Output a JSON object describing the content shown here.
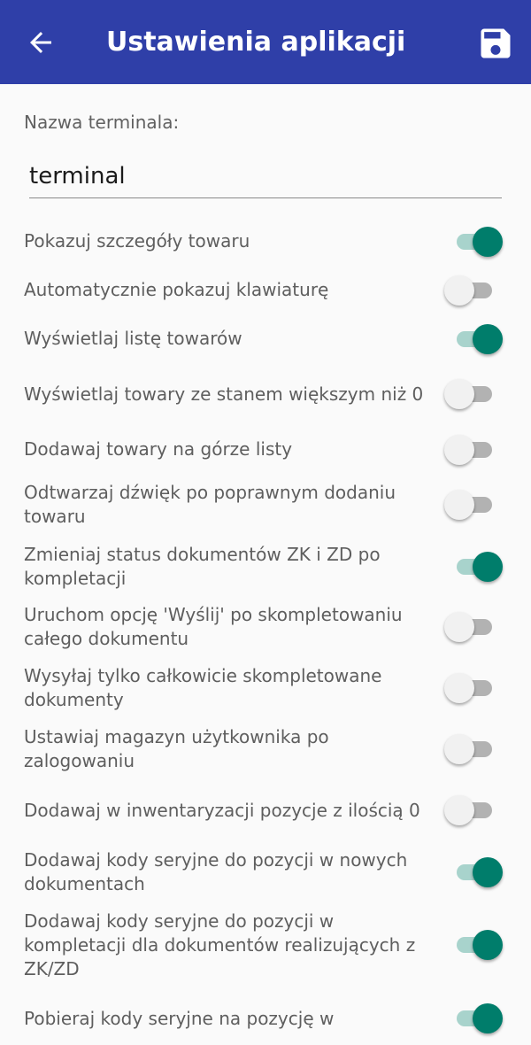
{
  "header": {
    "title": "Ustawienia aplikacji",
    "back_icon": "arrow-left-icon",
    "save_icon": "save-floppy-icon",
    "background": "#2f3fa8"
  },
  "terminal": {
    "label": "Nazwa terminala:",
    "value": "terminal"
  },
  "accent_color": "#007d6b",
  "settings": [
    {
      "label": "Pokazuj szczegóły towaru",
      "enabled": true
    },
    {
      "label": "Automatycznie pokazuj klawiaturę",
      "enabled": false
    },
    {
      "label": "Wyświetlaj listę towarów",
      "enabled": true
    },
    {
      "label": "Wyświetlaj towary ze stanem większym niż 0",
      "enabled": false
    },
    {
      "label": "Dodawaj towary na górze listy",
      "enabled": false
    },
    {
      "label": "Odtwarzaj dźwięk po poprawnym dodaniu towaru",
      "enabled": false
    },
    {
      "label": "Zmieniaj status dokumentów ZK i ZD po kompletacji",
      "enabled": true
    },
    {
      "label": "Uruchom opcję 'Wyślij' po skompletowaniu całego dokumentu",
      "enabled": false
    },
    {
      "label": "Wysyłaj tylko całkowicie skompletowane dokumenty",
      "enabled": false
    },
    {
      "label": "Ustawiaj magazyn użytkownika po zalogowaniu",
      "enabled": false
    },
    {
      "label": "Dodawaj w inwentaryzacji pozycje z ilością 0",
      "enabled": false
    },
    {
      "label": "Dodawaj kody seryjne do pozycji w nowych dokumentach",
      "enabled": true
    },
    {
      "label": "Dodawaj kody seryjne do pozycji w kompletacji dla dokumentów realizujących z ZK/ZD",
      "enabled": true
    },
    {
      "label": "Pobieraj kody seryjne na pozycję w",
      "enabled": true
    }
  ]
}
